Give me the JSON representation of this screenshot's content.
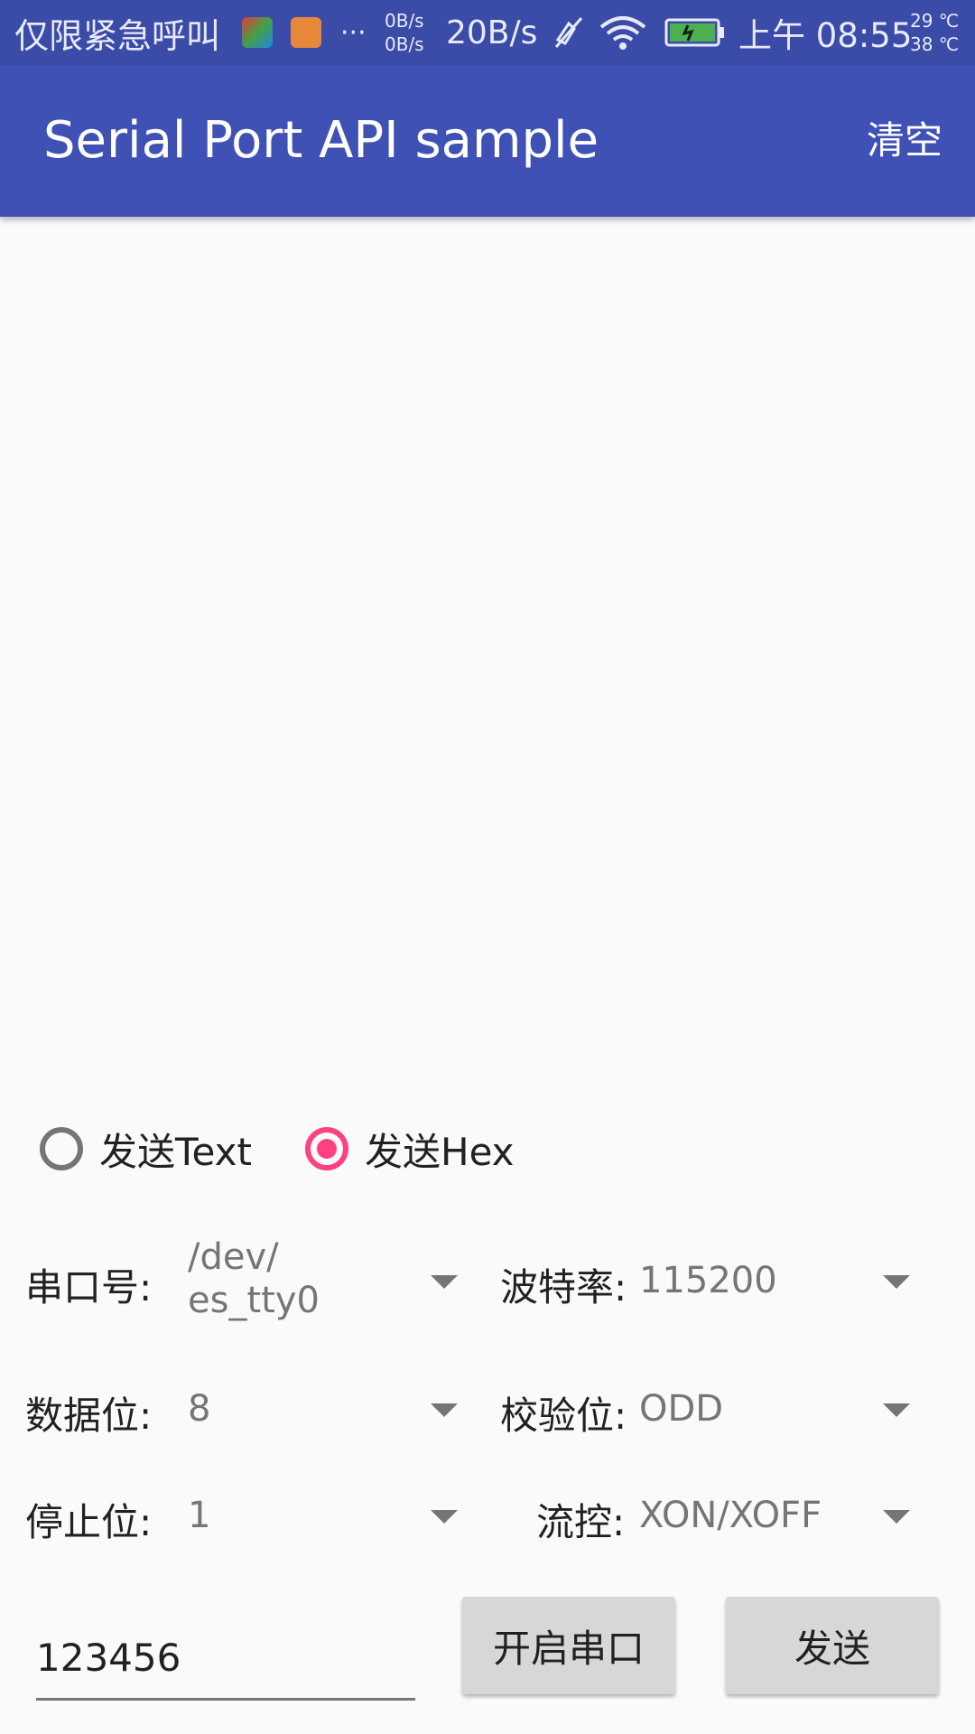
{
  "status_bar": {
    "carrier": "仅限紧急呼叫",
    "more": "···",
    "net_up": "0B/s",
    "net_down": "0B/s",
    "net_speed": "20B/s",
    "time": "上午 08:55",
    "temp_1": "29 ℃",
    "temp_2": "38 ℃",
    "icons": [
      "app-icon-colorful",
      "app-icon-orange",
      "mute-icon",
      "wifi-icon",
      "battery-charging-icon"
    ]
  },
  "app_bar": {
    "title": "Serial Port API sample",
    "action": "清空",
    "color": "#3f51b5"
  },
  "send_mode": {
    "options": [
      {
        "label": "发送Text",
        "checked": false
      },
      {
        "label": "发送Hex",
        "checked": true
      }
    ],
    "accent_color": "#ff4081"
  },
  "settings": {
    "port": {
      "label": "串口号:",
      "value_line1": "/dev/",
      "value_line2": "es_tty0"
    },
    "baud": {
      "label": "波特率:",
      "value": "115200"
    },
    "data_bits": {
      "label": "数据位:",
      "value": "8"
    },
    "parity": {
      "label": "校验位:",
      "value": "ODD"
    },
    "stop_bits": {
      "label": "停止位:",
      "value": "1"
    },
    "flow": {
      "label": "流控:",
      "value": "XON/XOFF"
    }
  },
  "input": {
    "value": "123456"
  },
  "buttons": {
    "open": "开启串口",
    "send": "发送"
  }
}
